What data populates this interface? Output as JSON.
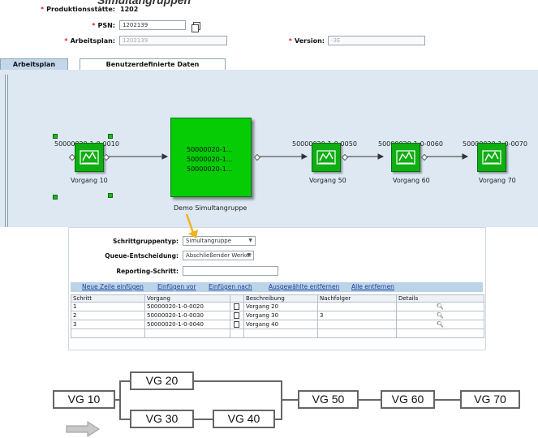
{
  "header": {
    "title_partial": "Simultangruppen",
    "produktionsstaette_label": "Produktionsstätte:",
    "produktionsstaette_value": "1202",
    "psn_label": "PSN:",
    "psn_value": "1202139",
    "arbeitsplan_label": "Arbeitsplan:",
    "arbeitsplan_value": "1202139",
    "version_label": "Version:",
    "version_value": "-3E"
  },
  "tabs": [
    {
      "label": "Arbeitsplan",
      "active": true
    },
    {
      "label": "Benutzerdefinierte Daten",
      "active": false
    }
  ],
  "canvas": {
    "nodes": [
      {
        "id": "50000020-1-0-0010",
        "label": "Vorgang 10"
      },
      {
        "id": "50000020-1-0-0050",
        "label": "Vorgang 50"
      },
      {
        "id": "50000020-1-0-0060",
        "label": "Vorgang 60"
      },
      {
        "id": "50000020-1-0-0070",
        "label": "Vorgang 70"
      }
    ],
    "group": {
      "lines": [
        "50000020-1...",
        "50000020-1...",
        "50000020-1..."
      ],
      "label": "Demo Simultangruppe"
    },
    "colors": {
      "node": "#0fae12",
      "group": "#05cc05",
      "pointer": "#f2b21c"
    }
  },
  "panel": {
    "schrittgruppentyp_label": "Schrittgruppentyp:",
    "schrittgruppentyp_value": "Simultangruppe",
    "queue_label": "Queue-Entscheidung:",
    "queue_value": "Abschließender Werker",
    "reporting_label": "Reporting-Schritt:",
    "reporting_value": "",
    "toolbar": [
      "Neue Zeile einfügen",
      "Einfügen vor",
      "Einfügen nach",
      "Ausgewählte entfernen",
      "Alle entfernen"
    ],
    "columns": [
      "Schritt",
      "Vorgang",
      "",
      "Beschreibung",
      "Nachfolger",
      "Details"
    ],
    "rows": [
      {
        "schritt": "1",
        "vorgang": "50000020-1-0-0020",
        "beschreibung": "Vorgang 20",
        "nachfolger": ""
      },
      {
        "schritt": "2",
        "vorgang": "50000020-1-0-0030",
        "beschreibung": "Vorgang 30",
        "nachfolger": "3"
      },
      {
        "schritt": "3",
        "vorgang": "50000020-1-0-0040",
        "beschreibung": "Vorgang 40",
        "nachfolger": ""
      }
    ]
  },
  "flow": {
    "boxes": [
      "VG 10",
      "VG 20",
      "VG 30",
      "VG 40",
      "VG 50",
      "VG 60",
      "VG 70"
    ],
    "arrow_color": "#c8c8c8"
  }
}
